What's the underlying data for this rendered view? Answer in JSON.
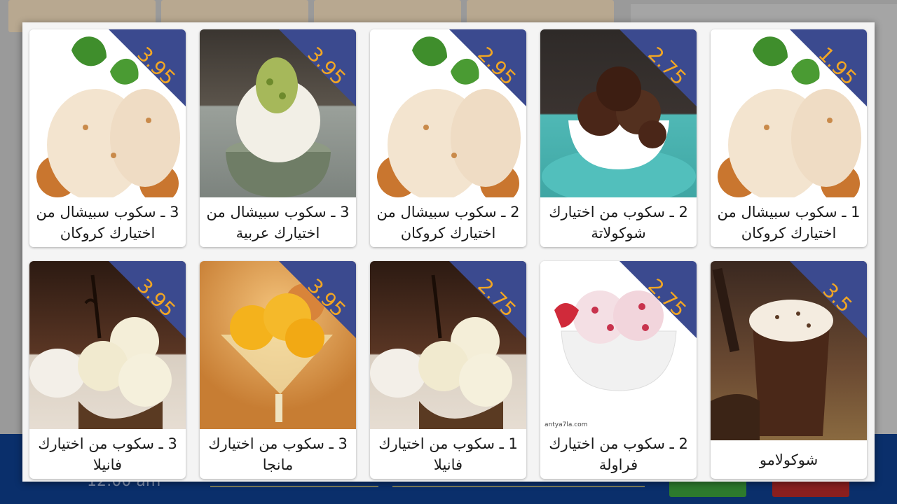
{
  "background": {
    "time_text": "12:00 am"
  },
  "menu_items": [
    {
      "title": "3 ـ سكوب سبيشال من اختيارك كروكان",
      "price": "3.95",
      "image": "caramel-crunch-scoops"
    },
    {
      "title": "3 ـ سكوب سبيشال من اختيارك عربية",
      "price": "3.95",
      "image": "arabic-pistachio-ice-cream"
    },
    {
      "title": "2 ـ سكوب سبيشال من اختيارك كروكان",
      "price": "2.95",
      "image": "caramel-crunch-scoops"
    },
    {
      "title": "2 ـ سكوب من اختيارك شوكولاتة",
      "price": "2.75",
      "image": "chocolate-scoops-bowl"
    },
    {
      "title": "1 ـ سكوب سبيشال من اختيارك كروكان",
      "price": "1.95",
      "image": "caramel-crunch-scoops"
    },
    {
      "title": "3 ـ سكوب من اختيارك فانيلا",
      "price": "3.95",
      "image": "vanilla-coconut-scoops"
    },
    {
      "title": "3 ـ سكوب من اختيارك مانجا",
      "price": "3.95",
      "image": "mango-sorbet-glass"
    },
    {
      "title": "1 ـ سكوب من اختيارك فانيلا",
      "price": "2.75",
      "image": "vanilla-coconut-scoops"
    },
    {
      "title": "2 ـ سكوب من اختيارك فراولة",
      "price": "2.75",
      "image": "strawberry-scoops-bowl",
      "watermark": "antya7la.com"
    },
    {
      "title": "شوكولامو",
      "price": "3.5",
      "image": "chocolate-drink-glass"
    }
  ],
  "colors": {
    "ribbon": "#3b4a8f",
    "price": "#f2a623",
    "bottom_bar": "#0a2f6b"
  }
}
